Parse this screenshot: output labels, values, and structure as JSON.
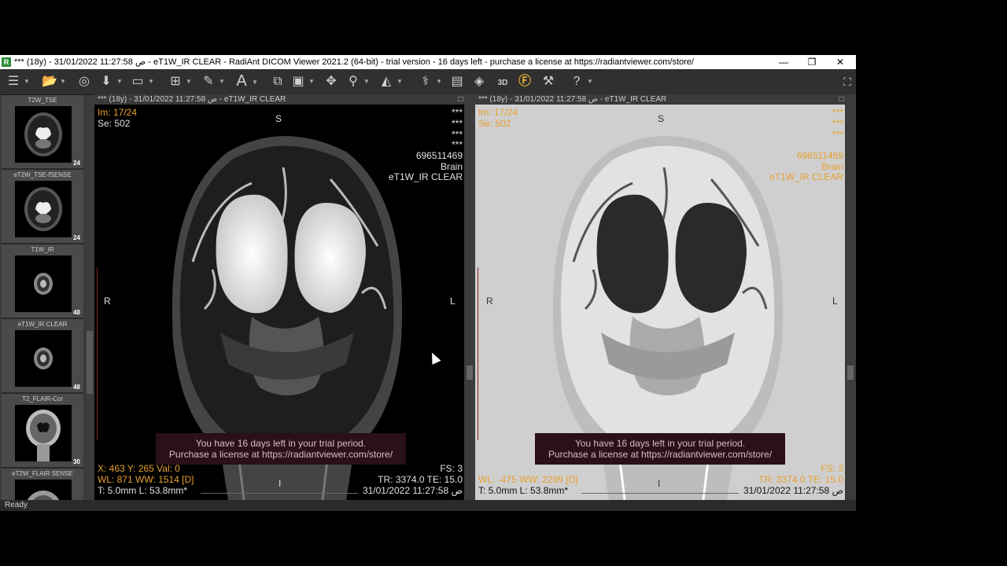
{
  "window": {
    "title": "*** (18y) - 31/01/2022 11:27:58 ص - eT1W_IR CLEAR - RadiAnt DICOM Viewer 2021.2 (64-bit) - trial version - 16 days left - purchase a license at https://radiantviewer.com/store/",
    "app_icon": "R",
    "minimize": "—",
    "restore": "❐",
    "close": "✕"
  },
  "toolbar": {
    "icons": [
      "menu-icon",
      "open-folder-icon",
      "cd-icon",
      "import-icon",
      "save-icon",
      "layout-icon",
      "measure-icon",
      "text-icon",
      "series-compare-icon",
      "stack-icon",
      "pan-icon",
      "zoom-icon",
      "window-level-icon",
      "fusion-icon",
      "video-icon",
      "mpr-icon",
      "3d-icon",
      "f-icon",
      "tools-icon",
      "help-icon"
    ],
    "fullscreen": "⛶"
  },
  "sidebar": {
    "series": [
      {
        "label": "T2W_TSE",
        "count": "24"
      },
      {
        "label": "eT2W_TSE-fSENSE",
        "count": "24"
      },
      {
        "label": "T1W_IR",
        "count": "48"
      },
      {
        "label": "eT1W_IR CLEAR",
        "count": "48"
      },
      {
        "label": "T2_FLAIR-Cor",
        "count": "30"
      },
      {
        "label": "eT2W_FLAIR SENSE",
        "count": ""
      }
    ]
  },
  "panes": {
    "left": {
      "header": "*** (18y) - 31/01/2022 11:27:58 ص - eT1W_IR CLEAR",
      "im": "Im: 17/24",
      "se": "Se: 502",
      "top_label": "S",
      "right_stars": [
        "***",
        "***",
        "***",
        "***"
      ],
      "id": "696511469",
      "region": "Brain",
      "series_name": "eT1W_IR CLEAR",
      "orient_left": "R",
      "orient_right": "L",
      "orient_bottom": "I",
      "coords": "X: 463 Y: 265 Val: 0",
      "wl": "WL: 871 WW: 1514 [D]",
      "thickness": "T: 5.0mm L: 53.8mm*",
      "fs": "FS: 3",
      "tr": "TR: 3374.0 TE: 15.0",
      "date": "31/01/2022 11:27:58 ص",
      "trial_line1": "You have 16 days left in your trial period.",
      "trial_line2": "Purchase a license at https://radiantviewer.com/store/"
    },
    "right": {
      "header": "*** (18y) - 31/01/2022 11:27:58 ص - eT1W_IR CLEAR",
      "im": "Im: 17/24",
      "se": "Se: 502",
      "top_label": "S",
      "right_stars": [
        "***",
        "***",
        "***"
      ],
      "id": "696511469",
      "region": "Brain",
      "series_name": "eT1W_IR CLEAR",
      "orient_left": "R",
      "orient_right": "L",
      "orient_bottom": "I",
      "wl": "WL: -475 WW: 2299 [D]",
      "thickness": "T: 5.0mm L: 53.8mm*",
      "fs": "FS: 3",
      "tr": "TR: 3374.0 TE: 15.0",
      "date": "31/01/2022 11:27:58 ص",
      "trial_line1": "You have 16 days left in your trial period.",
      "trial_line2": "Purchase a license at https://radiantviewer.com/store/"
    }
  },
  "status": "Ready"
}
